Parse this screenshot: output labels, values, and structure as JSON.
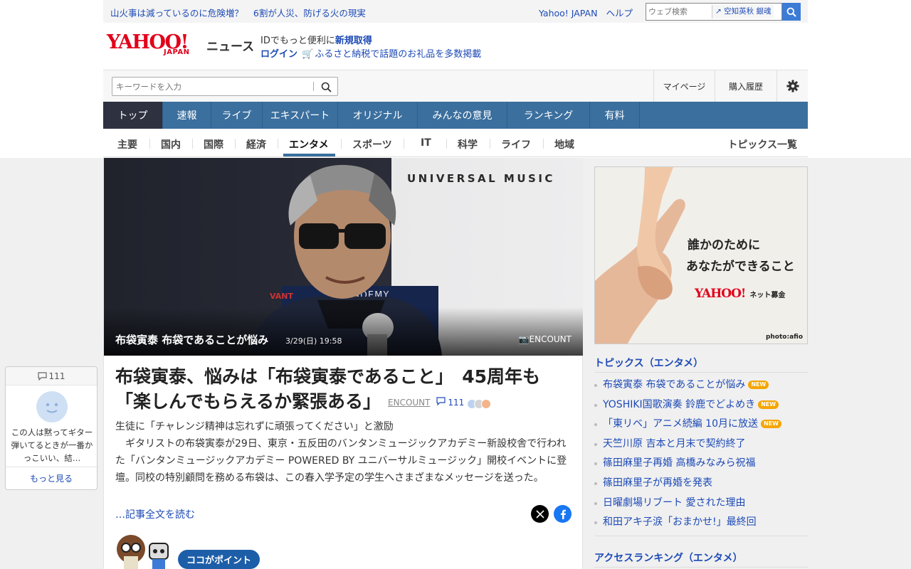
{
  "topbar": {
    "headlines": [
      "山火事は減っているのに危険増？",
      "6割が人災、防げる火の現実"
    ],
    "links": [
      "Yahoo! JAPAN",
      "ヘルプ"
    ],
    "web_search_placeholder": "ウェブ検索",
    "suggest": "空知英秋 銀魂"
  },
  "logo": {
    "yahoo": "YAHOO!",
    "japan": "JAPAN",
    "news": "ニュース"
  },
  "promo": {
    "line1_prefix": "IDでもっと便利に",
    "signup": "新規取得",
    "login": "ログイン",
    "furusato": "ふるさと納税で話題のお礼品を多数掲載"
  },
  "search": {
    "placeholder": "キーワードを入力",
    "mypage": "マイページ",
    "history": "購入履歴"
  },
  "categories": [
    "トップ",
    "速報",
    "ライブ",
    "エキスパート",
    "オリジナル",
    "みんなの意見",
    "ランキング",
    "有料"
  ],
  "subtabs": [
    "主要",
    "国内",
    "国際",
    "経済",
    "エンタメ",
    "スポーツ",
    "IT",
    "科学",
    "ライフ",
    "地域"
  ],
  "subtab_all": "トピックス一覧",
  "hero": {
    "caption": "布袋寅泰 布袋であることが悩み",
    "date": "3/29(日) 19:58",
    "credit": "ENCOUNT",
    "sign_text": "UNIVERSAL MUSIC",
    "sign_text2": "ADEMY",
    "sign_text3": "VANT"
  },
  "article": {
    "title": "布袋寅泰、悩みは「布袋寅泰であること」　45周年も「楽しんでもらえるか緊張ある」",
    "source": "ENCOUNT",
    "comments": "111",
    "lead1": "生徒に「チャレンジ精神は忘れずに頑張ってください」と激励",
    "lead2": "　ギタリストの布袋寅泰が29日、東京・五反田のバンタンミュージックアカデミー新設校舎で行われた「バンタンミュージックアカデミー POWERED BY ユニバーサルミュージック」開校イベントに登壇。同校の特別顧問を務める布袋は、この春入学予定の学生へさまざまなメッセージを送った。",
    "readmore": "…記事全文を読む",
    "point": "ココがポイント"
  },
  "ad": {
    "line1": "誰かのために",
    "line2": "あなたができること",
    "brand": "YAHOO!",
    "brand_sub": "ネット募金",
    "photo": "photo:afio"
  },
  "topics": {
    "heading": "トピックス（エンタメ）",
    "new_label": "NEW",
    "items": [
      {
        "title": "布袋寅泰 布袋であることが悩み",
        "new": true
      },
      {
        "title": "YOSHIKI国歌演奏 鈴鹿でどよめき",
        "new": true
      },
      {
        "title": "「東リベ」アニメ続編 10月に放送",
        "new": true
      },
      {
        "title": "天竺川原 吉本と月末で契約終了",
        "new": false
      },
      {
        "title": "篠田麻里子再婚 高橋みなみら祝福",
        "new": false
      },
      {
        "title": "篠田麻里子が再婚を発表",
        "new": false
      },
      {
        "title": "日曜劇場リブート 愛された理由",
        "new": false
      },
      {
        "title": "和田アキ子涙「おまかせ!」最終回",
        "new": false
      }
    ]
  },
  "ranking_heading": "アクセスランキング（エンタメ）",
  "comment_widget": {
    "count": "111",
    "text": "この人は黙ってギター弾いてるときが一番かっこいい、結…",
    "more": "もっと見る"
  },
  "colors": {
    "accent": "#1d4ab6",
    "nav": "#3b6f9e",
    "brand_red": "#e2001a"
  }
}
